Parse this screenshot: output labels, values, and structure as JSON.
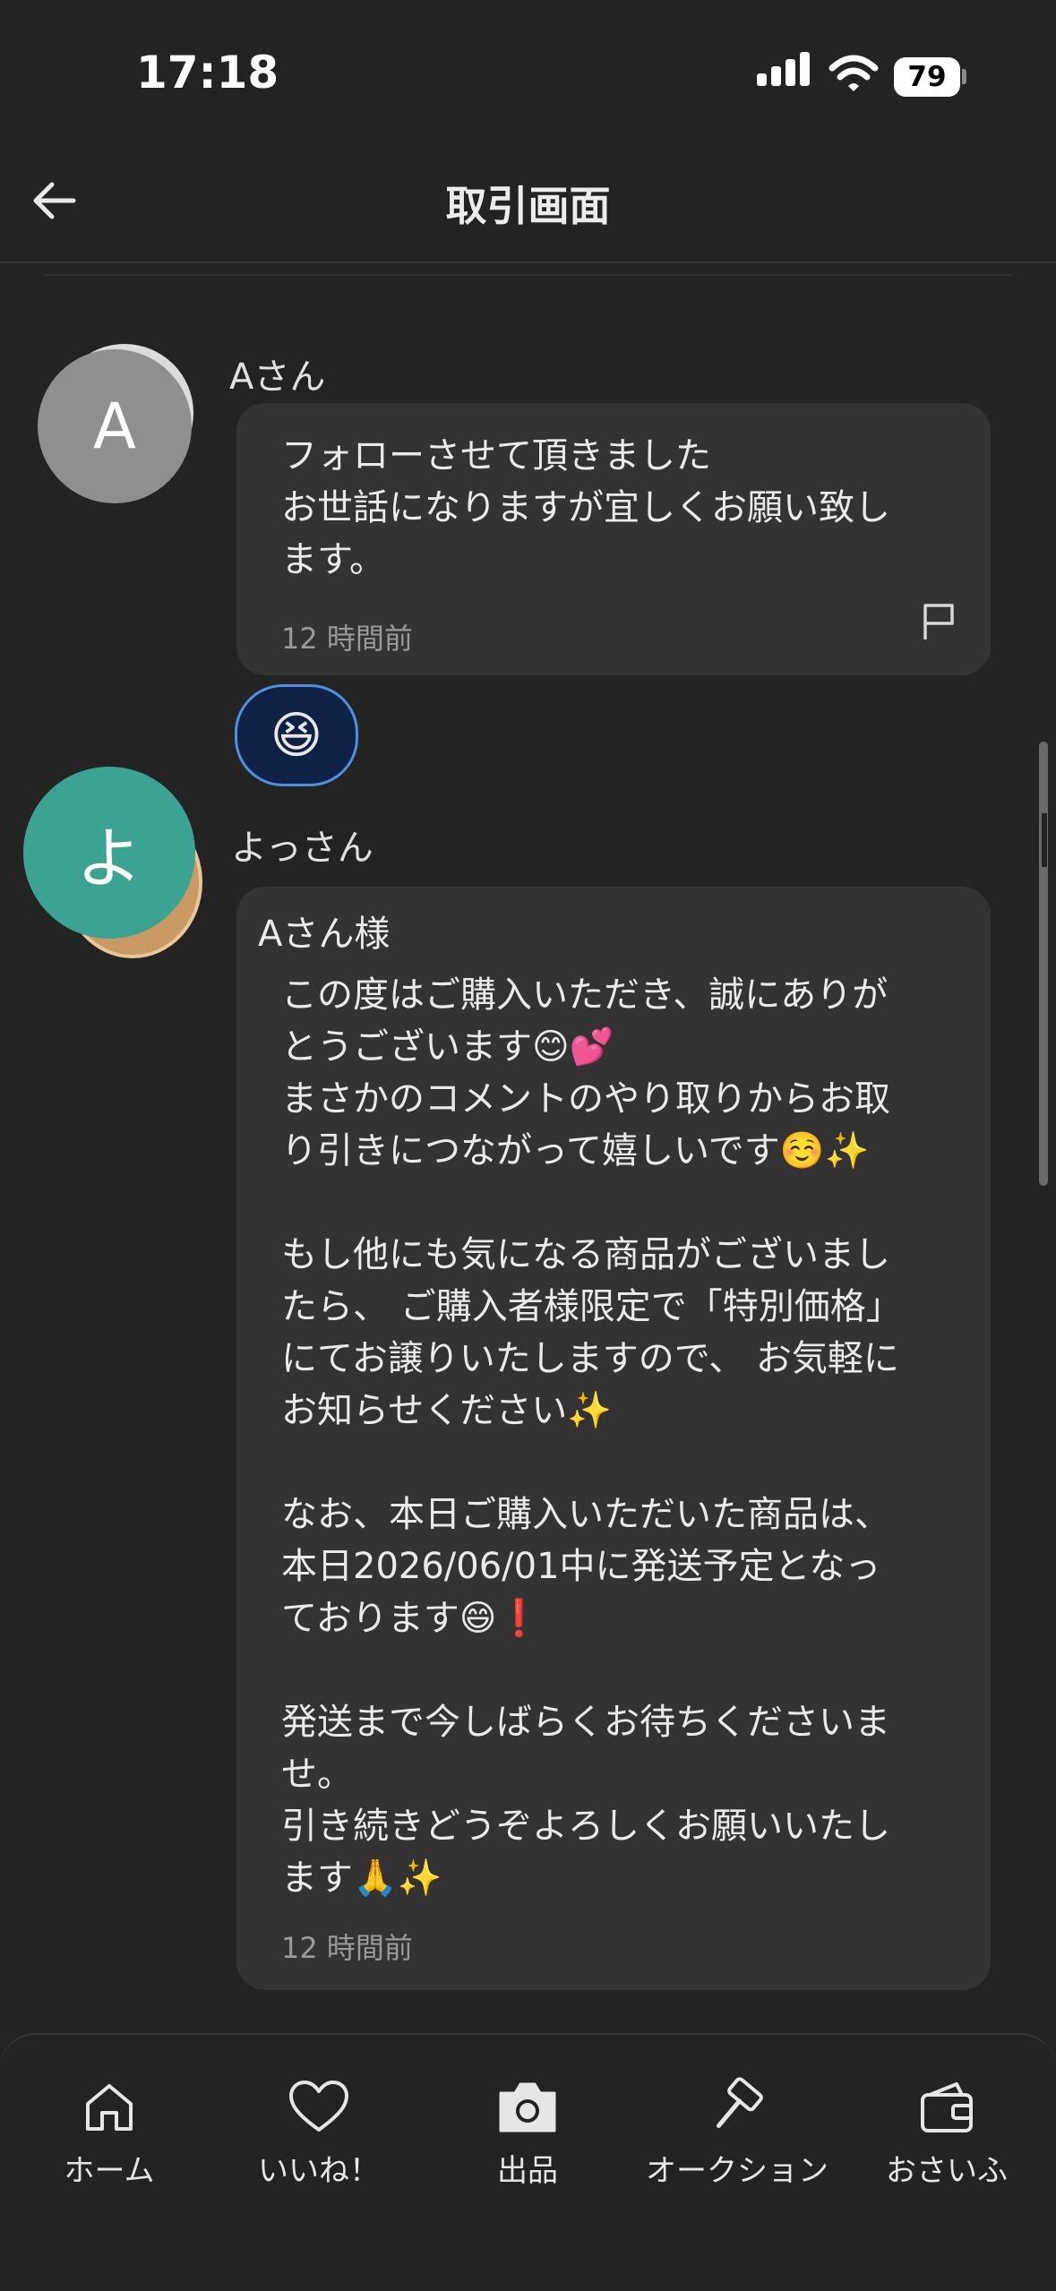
{
  "status_bar": {
    "time": "17:18",
    "battery": "79"
  },
  "header": {
    "title": "取引画面"
  },
  "messages": [
    {
      "sender": "Aさん",
      "avatar_letter": "A",
      "lines": [
        "フォローさせて頂きました",
        "お世話になりますが宜しくお願い致し",
        "ます。"
      ],
      "time": "12 時間前",
      "reaction": "😆"
    },
    {
      "sender": "よっさん",
      "avatar_letter": "よ",
      "salutation": "Aさん様",
      "lines": [
        "この度はご購入いただき、誠にありが",
        "とうございます😊💕",
        "まさかのコメントのやり取りからお取",
        "り引きにつながって嬉しいです☺️✨",
        "",
        "もし他にも気になる商品がございまし",
        "たら、 ご購入者様限定で「特別価格」",
        "にてお譲りいたしますので、 お気軽に",
        "お知らせください✨",
        "",
        "なお、本日ご購入いただいた商品は、",
        "本日2026/06/01中に発送予定となっ",
        "ております😄❗",
        "",
        "発送まで今しばらくお待ちくださいま",
        "せ。",
        "引き続きどうぞよろしくお願いいたし",
        "ます🙏✨"
      ],
      "time": "12 時間前"
    }
  ],
  "tabs": [
    {
      "label": "ホーム",
      "icon": "home-icon"
    },
    {
      "label": "いいね！",
      "icon": "heart-icon"
    },
    {
      "label": "出品",
      "icon": "camera-icon"
    },
    {
      "label": "オークション",
      "icon": "gavel-icon"
    },
    {
      "label": "おさいふ",
      "icon": "wallet-icon"
    }
  ]
}
